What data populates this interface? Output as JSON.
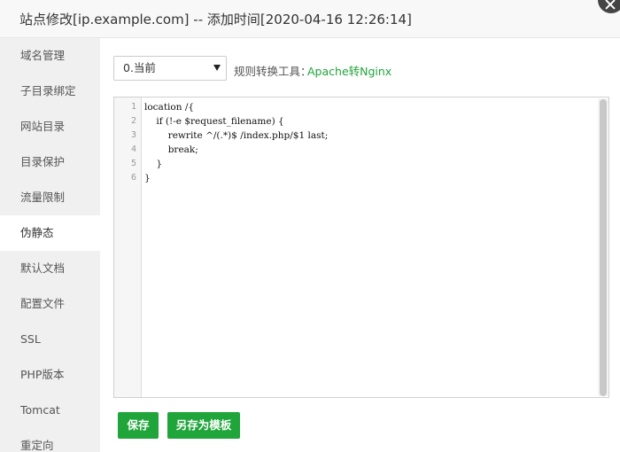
{
  "dialog": {
    "title": "站点修改[ip.example.com] -- 添加时间[2020-04-16 12:26:14]"
  },
  "sidebar": {
    "items": [
      {
        "label": "域名管理"
      },
      {
        "label": "子目录绑定"
      },
      {
        "label": "网站目录"
      },
      {
        "label": "目录保护"
      },
      {
        "label": "流量限制"
      },
      {
        "label": "伪静态"
      },
      {
        "label": "默认文档"
      },
      {
        "label": "配置文件"
      },
      {
        "label": "SSL"
      },
      {
        "label": "PHP版本"
      },
      {
        "label": "Tomcat"
      },
      {
        "label": "重定向"
      }
    ],
    "active_item": "伪静态"
  },
  "rewrite": {
    "template_select": "0.当前",
    "rule_tool_label": "规则转换工具：",
    "rule_tool_link": "Apache转Nginx"
  },
  "editor": {
    "line_numbers": [
      "1",
      "2",
      "3",
      "4",
      "5",
      "6"
    ],
    "lines": [
      "location /{",
      "    if (!-e $request_filename) {",
      "        rewrite ^/(.*)$ /index.php/$1 last;",
      "        break;",
      "    }",
      "}"
    ]
  },
  "actions": {
    "save_label": "保存",
    "save_as_template_label": "另存为模板"
  },
  "colors": {
    "accent": "#20a53a",
    "sidebar_bg": "#f0f0f0",
    "title_bar_bg": "#f8f8f8"
  }
}
